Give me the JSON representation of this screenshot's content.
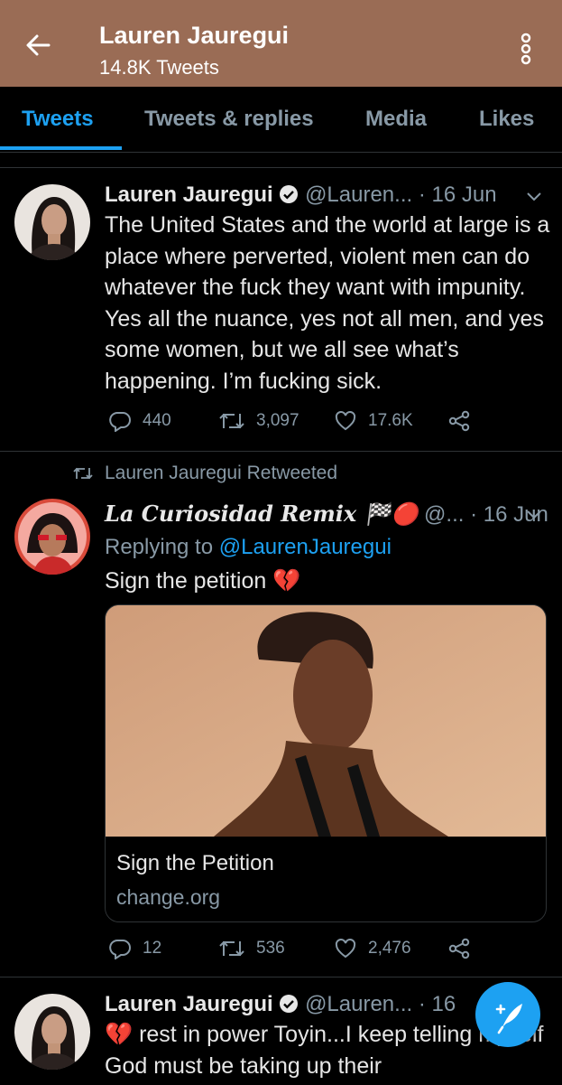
{
  "header": {
    "title": "Lauren Jauregui",
    "subtitle": "14.8K Tweets"
  },
  "tabs": [
    {
      "label": "Tweets",
      "active": true
    },
    {
      "label": "Tweets & replies",
      "active": false
    },
    {
      "label": "Media",
      "active": false
    },
    {
      "label": "Likes",
      "active": false
    }
  ],
  "tweets": [
    {
      "name": "Lauren Jauregui",
      "handle": "@Lauren...",
      "date": "16 Jun",
      "text": "The United States and the world at large is a place where perverted, violent men can do whatever the fuck they want with impunity. Yes all the nuance, yes not all men, and yes some women, but we all see what’s happening. I’m fucking sick.",
      "replies": "440",
      "retweets": "3,097",
      "likes": "17.6K"
    },
    {
      "retweet_label": "Lauren Jauregui Retweeted",
      "name": "La Curiosidad Remix 🏁🔴",
      "handle": "@...",
      "date": "16 Jun",
      "replying_prefix": "Replying to",
      "replying_to": "@LaurenJauregui",
      "text": "Sign the petition 💔",
      "card_title": "Sign the Petition",
      "card_domain": "change.org",
      "replies": "12",
      "retweets": "536",
      "likes": "2,476"
    },
    {
      "name": "Lauren Jauregui",
      "handle": "@Lauren...",
      "date": "16",
      "text": "💔 rest in power Toyin...I keep telling myself God must be taking up their"
    }
  ],
  "colors": {
    "header_bg": "#9a6c55",
    "accent": "#1da1f2",
    "muted": "#8899a6"
  },
  "icons": [
    "back-arrow-icon",
    "more-vertical-icon",
    "verified-icon",
    "chevron-down-icon",
    "reply-icon",
    "retweet-icon",
    "like-icon",
    "share-icon",
    "compose-icon"
  ]
}
